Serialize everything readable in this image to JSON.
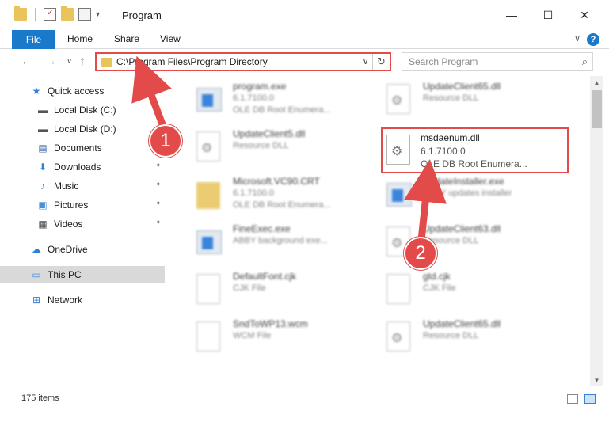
{
  "window": {
    "title": "Program",
    "minimize_label": "—",
    "maximize_label": "☐",
    "close_label": "✕"
  },
  "ribbon": {
    "tabs": [
      "File",
      "Home",
      "Share",
      "View"
    ],
    "help_label": "?",
    "collapse_label": "∨"
  },
  "navigation": {
    "back_label": "←",
    "forward_label": "→",
    "recent_label": "∨",
    "up_label": "↑",
    "address": "C:\\Program Files\\Program Directory",
    "address_dropdown_label": "∨",
    "refresh_label": "↻",
    "search_placeholder": "Search Program",
    "search_icon_label": "⌕"
  },
  "sidebar": {
    "items": [
      {
        "label": "Quick access",
        "icon": "star-icon",
        "glyph": "★",
        "color": "#2f7fd8"
      },
      {
        "label": "Local Disk (C:)",
        "icon": "drive-icon",
        "glyph": "▬",
        "color": "#555555"
      },
      {
        "label": "Local Disk (D:)",
        "icon": "drive-icon",
        "glyph": "▬",
        "color": "#555555"
      },
      {
        "label": "Documents",
        "icon": "documents-icon",
        "glyph": "▤",
        "color": "#4a6fa5"
      },
      {
        "label": "Downloads",
        "icon": "download-icon",
        "glyph": "⬇",
        "color": "#2f7fd8"
      },
      {
        "label": "Music",
        "icon": "music-icon",
        "glyph": "♪",
        "color": "#2f7fd8"
      },
      {
        "label": "Pictures",
        "icon": "pictures-icon",
        "glyph": "▣",
        "color": "#4a8fd6"
      },
      {
        "label": "Videos",
        "icon": "videos-icon",
        "glyph": "▦",
        "color": "#555555"
      },
      {
        "label": "OneDrive",
        "icon": "cloud-icon",
        "glyph": "☁",
        "color": "#2f7fd8"
      },
      {
        "label": "This PC",
        "icon": "computer-icon",
        "glyph": "▭",
        "color": "#4a8fd6"
      },
      {
        "label": "Network",
        "icon": "network-icon",
        "glyph": "⊞",
        "color": "#2f7fd8"
      }
    ],
    "pin_glyph": "📌"
  },
  "files": [
    {
      "name": "program.exe",
      "line1": "6.1.7100.0",
      "line2": "OLE DB Root Enumera...",
      "icon": "exe"
    },
    {
      "name": "UpdateClient65.dll",
      "line1": "Resource DLL",
      "line2": "",
      "icon": "dll"
    },
    {
      "name": "UpdateClient5.dll",
      "line1": "Resource DLL",
      "line2": "",
      "icon": "dll"
    },
    {
      "name": "msdaenum.dll",
      "line1": "6.1.7100.0",
      "line2": "OLE DB Root Enumera...",
      "icon": "dll"
    },
    {
      "name": "Microsoft.VC90.CRT",
      "line1": "6.1.7100.0",
      "line2": "OLE DB Root Enumera...",
      "icon": "folder"
    },
    {
      "name": "UpdateInstaller.exe",
      "line1": "ABBY updates installer",
      "line2": "",
      "icon": "exe"
    },
    {
      "name": "FineExec.exe",
      "line1": "ABBY background exe...",
      "line2": "",
      "icon": "exe"
    },
    {
      "name": "UpdateClient63.dll",
      "line1": "Resource DLL",
      "line2": "",
      "icon": "dll"
    },
    {
      "name": "DefaultFont.cjk",
      "line1": "CJK File",
      "line2": "",
      "icon": "plain"
    },
    {
      "name": "gtd.cjk",
      "line1": "CJK File",
      "line2": "",
      "icon": "plain"
    },
    {
      "name": "SndToWP13.wcm",
      "line1": "WCM File",
      "line2": "",
      "icon": "plain"
    },
    {
      "name": "UpdateClient65.dll",
      "line1": "Resource DLL",
      "line2": "",
      "icon": "dll"
    }
  ],
  "annotations": {
    "step1": "1",
    "step2": "2",
    "color": "#e34a4a"
  },
  "status": {
    "item_count": "175 items"
  }
}
